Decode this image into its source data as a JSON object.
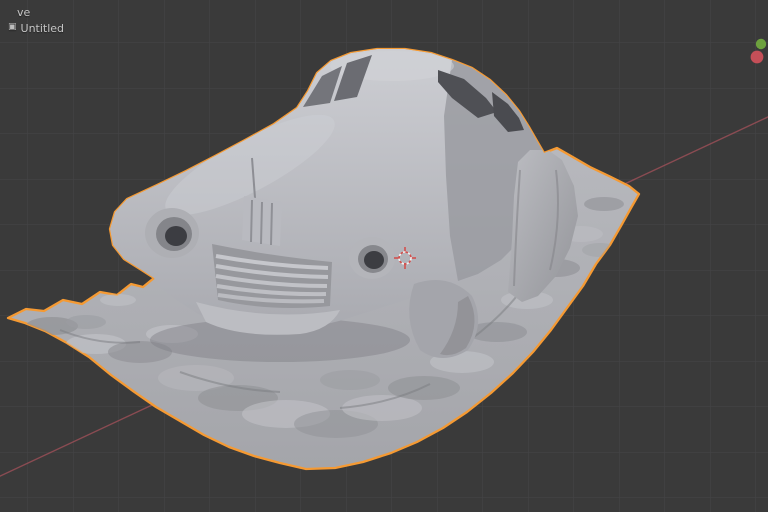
{
  "viewport": {
    "overlay_text_line1": "ve",
    "overlay_text_line2": "Untitled"
  },
  "icons": {
    "scene_collection": "▣"
  },
  "colors": {
    "background": "#3a3a3a",
    "grid_line": "#454548",
    "selection_outline": "#f59a33",
    "axis_x": "#9f5058",
    "gizmo_green": "#6da13e",
    "gizmo_red": "#c44f58",
    "cursor_red": "#d2504e",
    "cursor_white": "#f2f2f2",
    "overlay_text": "#c6c6c6",
    "model_light": "#cdced3",
    "model_mid": "#aeafb5",
    "model_dark": "#8d8e93",
    "window_opening": "#4f5055"
  }
}
